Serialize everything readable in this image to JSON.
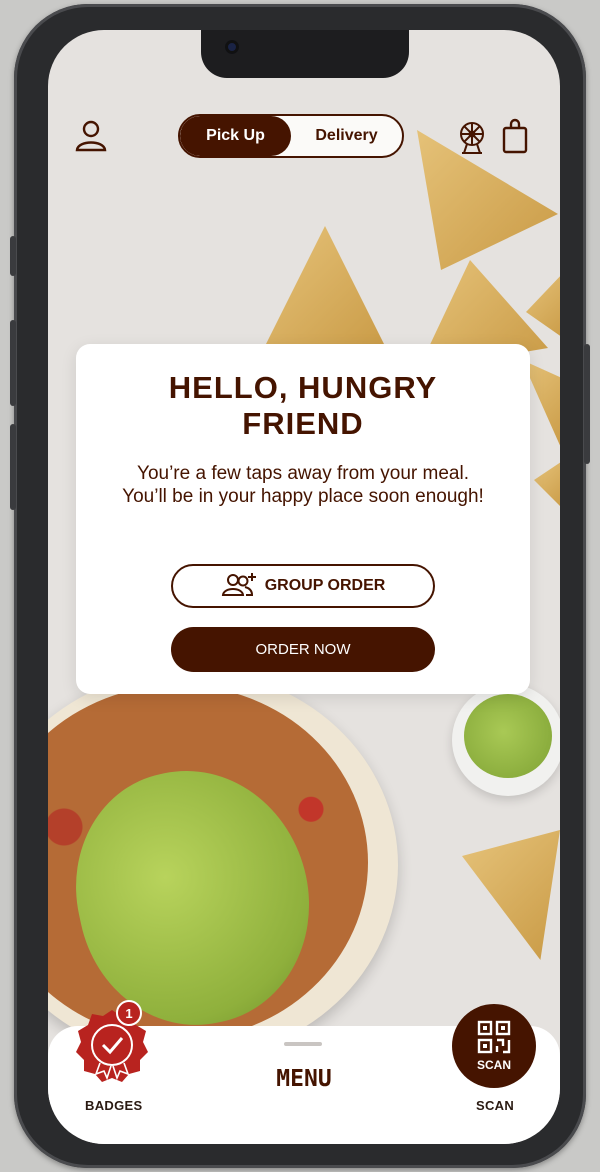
{
  "header": {
    "account_icon": "user-icon",
    "toggle": {
      "pickup_label": "Pick Up",
      "delivery_label": "Delivery",
      "active": "pickup"
    },
    "rewards_icon": "prize-wheel-icon",
    "bag_icon": "shopping-bag-icon"
  },
  "card": {
    "title": "HELLO, HUNGRY FRIEND",
    "subtitle": "You’re a few taps away from your meal. You’ll be in your happy place soon enough!",
    "group_order_label": "GROUP ORDER",
    "group_order_icon": "group-add-icon",
    "order_now_label": "ORDER NOW"
  },
  "bottom_nav": {
    "badges_label": "BADGES",
    "badges_count": "1",
    "menu_label": "MENU",
    "scan_button_label": "SCAN",
    "scan_label": "SCAN"
  },
  "colors": {
    "brand_brown": "#451400",
    "badge_red": "#b8231f",
    "background": "#e5e2df"
  }
}
